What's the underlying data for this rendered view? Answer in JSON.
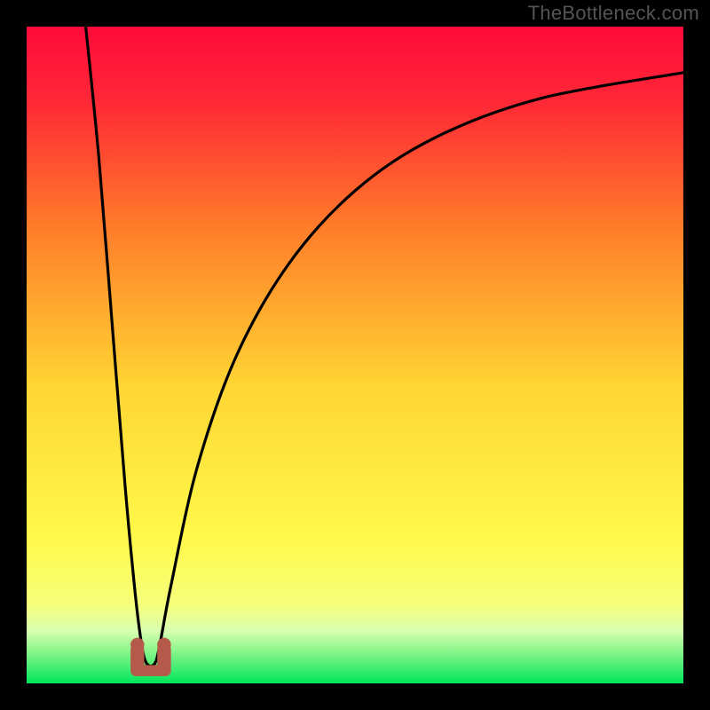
{
  "watermark": "TheBottleneck.com",
  "chart_data": {
    "type": "line",
    "title": "",
    "xlabel": "",
    "ylabel": "",
    "xlim": [
      0,
      100
    ],
    "ylim": [
      0,
      100
    ],
    "background_gradient": [
      "#ff0033",
      "#ff7a29",
      "#ffd633",
      "#ffff55",
      "#00e65c"
    ],
    "green_band_y": [
      0,
      7
    ],
    "curve": {
      "name": "bottleneck-curve",
      "color": "#000000",
      "points": [
        {
          "x": 9,
          "y": 100
        },
        {
          "x": 11,
          "y": 80
        },
        {
          "x": 13,
          "y": 55
        },
        {
          "x": 15,
          "y": 30
        },
        {
          "x": 16.5,
          "y": 14
        },
        {
          "x": 17.5,
          "y": 6
        },
        {
          "x": 18.3,
          "y": 3
        },
        {
          "x": 19.5,
          "y": 3
        },
        {
          "x": 20.3,
          "y": 6
        },
        {
          "x": 22,
          "y": 15
        },
        {
          "x": 26,
          "y": 33
        },
        {
          "x": 32,
          "y": 50
        },
        {
          "x": 40,
          "y": 64
        },
        {
          "x": 50,
          "y": 75
        },
        {
          "x": 62,
          "y": 83
        },
        {
          "x": 78,
          "y": 89
        },
        {
          "x": 100,
          "y": 93
        }
      ]
    },
    "marker": {
      "name": "u-marker",
      "color": "#b55a4a",
      "cx": 18.9,
      "cy": 3.5,
      "rx": 2.2,
      "ry": 3.0
    }
  }
}
